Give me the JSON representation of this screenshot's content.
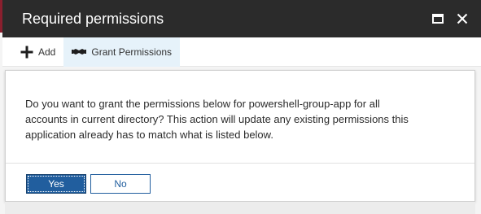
{
  "window": {
    "title": "Required permissions",
    "maximize_icon": "maximize-icon",
    "close_icon": "close-icon"
  },
  "toolbar": {
    "add_label": "Add",
    "add_icon": "plus-icon",
    "grant_label": "Grant Permissions",
    "grant_icon": "handshake-icon"
  },
  "dialog": {
    "message_line1": "Do you want to grant the permissions below for powershell-group-app for all",
    "message_line2": "accounts in current directory? This action will update any existing permissions this",
    "message_line3": "application already has to match what is listed below.",
    "yes_label": "Yes",
    "no_label": "No"
  },
  "colors": {
    "titlebar": "#2b2b2b",
    "accent": "#215e9e",
    "active_toolbar_bg": "#e6f2fa",
    "left_accent": "#8a1f2e"
  }
}
